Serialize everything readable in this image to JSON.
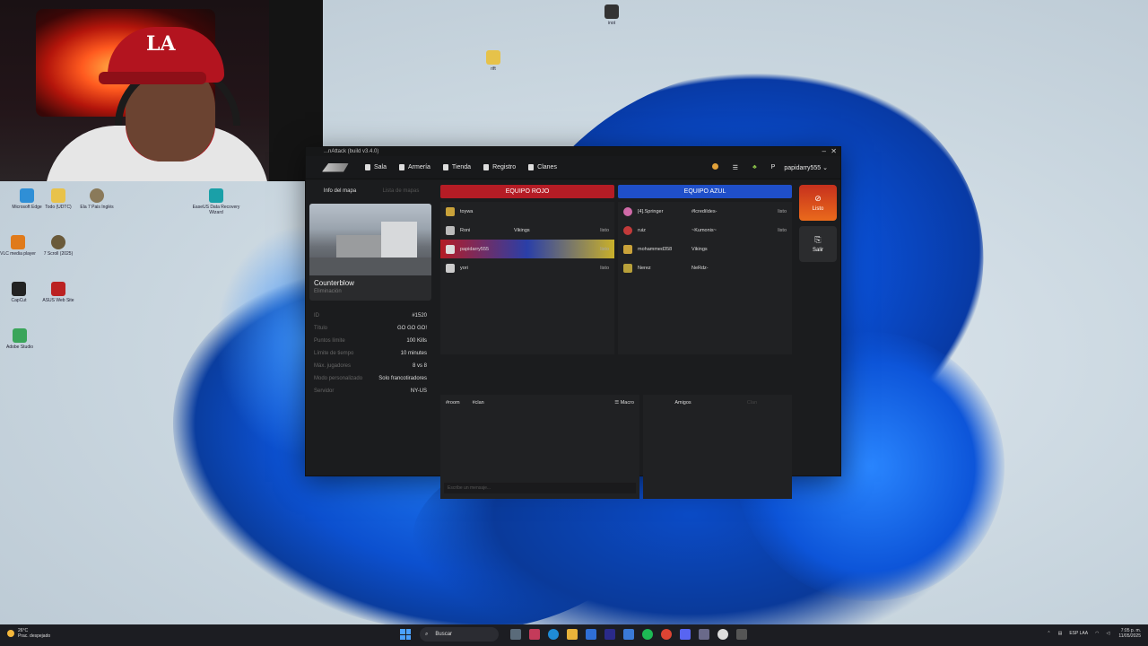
{
  "app": {
    "title": "...nAttack (build v3.4.0)",
    "nav": [
      "Sala",
      "Armería",
      "Tienda",
      "Registro",
      "Clanes"
    ],
    "user_initial": "P",
    "username": "papidarry555 ⌄"
  },
  "left": {
    "tabs": [
      "Info del mapa",
      "Lista de mapas"
    ],
    "map_name": "Counterblow",
    "map_mode": "Eliminación",
    "info": [
      {
        "k": "ID",
        "v": "#1520"
      },
      {
        "k": "Título",
        "v": "GO GO GO!"
      },
      {
        "k": "Puntos límite",
        "v": "100 Kills"
      },
      {
        "k": "Límite de tiempo",
        "v": "10 minutes"
      },
      {
        "k": "Máx. jugadores",
        "v": "8 vs 8"
      },
      {
        "k": "Modo personalizado",
        "v": "Solo francotiradores"
      },
      {
        "k": "Servidor",
        "v": "NY-US"
      }
    ]
  },
  "teams": {
    "red_label": "EQUIPO ROJO",
    "blue_label": "EQUIPO AZUL",
    "red": [
      {
        "name": "toywa",
        "clan": "",
        "state": ""
      },
      {
        "name": "Roni",
        "clan": "Vikings",
        "state": "listo"
      },
      {
        "name": "papidarry555",
        "clan": "",
        "state": "listo"
      },
      {
        "name": "yori",
        "clan": "",
        "state": "listo"
      }
    ],
    "blue": [
      {
        "name": "[4].Springer",
        "clan": "#lcrediIdes-",
        "state": "listo"
      },
      {
        "name": "ruiz",
        "clan": "~Kumonis~",
        "state": "listo"
      },
      {
        "name": "mohammed358",
        "clan": "Vikings",
        "state": ""
      },
      {
        "name": "Nerez",
        "clan": "NeRdz-",
        "state": ""
      }
    ]
  },
  "chat": {
    "tabs": [
      "#room",
      "#clan"
    ],
    "macro": "☰ Macro",
    "placeholder": "Escribe un mensaje..."
  },
  "friends": {
    "tabs": [
      "Amigos",
      "Clan"
    ]
  },
  "side": {
    "ready": "Listo",
    "exit": "Salir"
  },
  "desktop_icons": [
    "Microsoft Edge",
    "Todo (UDTC)",
    "Ela 7 Pais Inglés",
    "EaseUS Data Recovery Wizard",
    "VLC media player",
    "7 Scroll (2025)",
    "CapCut",
    "ASUS Web Site",
    "Adobe Studio",
    "rift",
    "inot"
  ],
  "taskbar": {
    "weather_temp": "26°C",
    "weather_desc": "Prac. despejado",
    "search": "Buscar",
    "lang": "ESP LAA",
    "time": "7:05 p. m.",
    "date": "11/05/2025"
  },
  "colors": {
    "red_team": "#b51c25",
    "blue_team": "#1f4fc9",
    "ready_btn": "#e0541d"
  }
}
